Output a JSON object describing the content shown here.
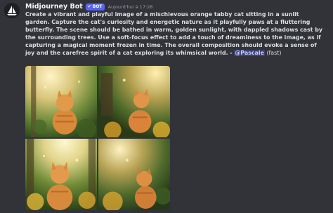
{
  "author": {
    "name": "Midjourney Bot",
    "bot_tag": "BOT",
    "timestamp": "Aujourd'hui à 17:28"
  },
  "message": {
    "prompt": "Create a vibrant and playful image of a mischievous orange tabby cat sitting in a sunlit garden. Capture the cat's curiosity and energetic nature as it playfully paws at a fluttering butterfly. The scene should be bathed in warm, golden sunlight, with dappled shadows cast by the surrounding trees. Use a soft-focus effect to add a touch of dreaminess to the image, as if capturing a magical moment frozen in time. The overall composition should evoke a sense of joy and the carefree spirit of a cat exploring its whimsical world.",
    "separator": " - ",
    "mention": "@Pascale",
    "mode": " (fast)"
  },
  "images": [
    {
      "theme": "sunlit-garden-cat-1"
    },
    {
      "theme": "sunlit-garden-cat-2"
    },
    {
      "theme": "sunlit-garden-cat-3"
    },
    {
      "theme": "sunlit-garden-cat-4"
    }
  ],
  "colors": {
    "background": "#313338",
    "bot_tag": "#5865f2",
    "mention_bg": "#3c4270",
    "mention_text": "#c9cdfb"
  }
}
